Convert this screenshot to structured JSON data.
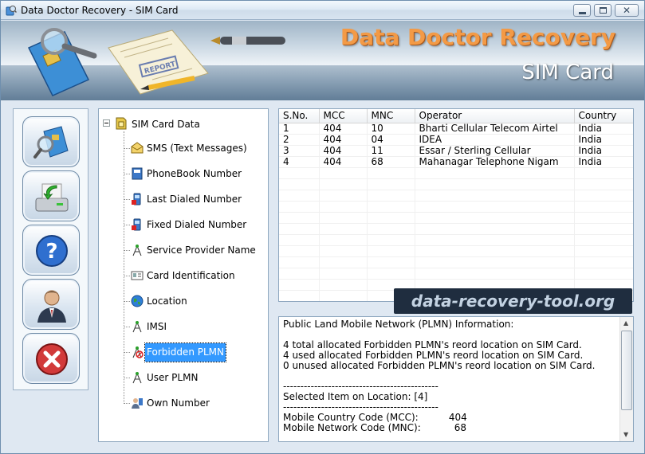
{
  "window": {
    "title": "Data Doctor Recovery - SIM Card"
  },
  "banner": {
    "brand": "Data Doctor Recovery",
    "product": "SIM Card",
    "stamp_text": "REPORT"
  },
  "toolbar": {
    "buttons": [
      {
        "name": "scan-sim-button",
        "icon": "sim-search-icon"
      },
      {
        "name": "save-button",
        "icon": "save-drive-icon"
      },
      {
        "name": "help-button",
        "icon": "help-icon"
      },
      {
        "name": "about-button",
        "icon": "user-icon"
      },
      {
        "name": "exit-button",
        "icon": "close-icon"
      }
    ]
  },
  "tree": {
    "root": "SIM Card Data",
    "items": [
      {
        "label": "SMS (Text Messages)",
        "icon": "envelope-icon"
      },
      {
        "label": "PhoneBook Number",
        "icon": "phonebook-icon"
      },
      {
        "label": "Last Dialed Number",
        "icon": "phone-icon"
      },
      {
        "label": "Fixed Dialed Number",
        "icon": "phone-icon"
      },
      {
        "label": "Service Provider Name",
        "icon": "antenna-icon"
      },
      {
        "label": "Card Identification",
        "icon": "id-card-icon"
      },
      {
        "label": "Location",
        "icon": "globe-icon"
      },
      {
        "label": "IMSI",
        "icon": "antenna-icon"
      },
      {
        "label": "Forbidden PLMN",
        "icon": "forbidden-antenna-icon",
        "selected": true
      },
      {
        "label": "User PLMN",
        "icon": "antenna-icon"
      },
      {
        "label": "Own Number",
        "icon": "person-phone-icon"
      }
    ]
  },
  "table": {
    "columns": [
      "S.No.",
      "MCC",
      "MNC",
      "Operator",
      "Country"
    ],
    "rows": [
      [
        "1",
        "404",
        "10",
        "Bharti Cellular Telecom Airtel",
        "India"
      ],
      [
        "2",
        "404",
        "04",
        "IDEA",
        "India"
      ],
      [
        "3",
        "404",
        "11",
        "Essar / Sterling Cellular",
        "India"
      ],
      [
        "4",
        "404",
        "68",
        "Mahanagar Telephone Nigam",
        "India"
      ]
    ],
    "empty_rows": 12
  },
  "watermark": "data-recovery-tool.org",
  "info": {
    "lines": [
      "Public Land Mobile Network (PLMN) Information:",
      "",
      "4 total allocated Forbidden PLMN's reord location on SIM Card.",
      "4 used allocated Forbidden PLMN's reord location on SIM Card.",
      "0 unused allocated Forbidden PLMN's reord location on SIM Card.",
      "",
      "---------------------------------------------",
      "Selected Item on Location: [4]",
      "---------------------------------------------",
      "Mobile Country Code (MCC):          404",
      "Mobile Network Code (MNC):           68"
    ]
  }
}
